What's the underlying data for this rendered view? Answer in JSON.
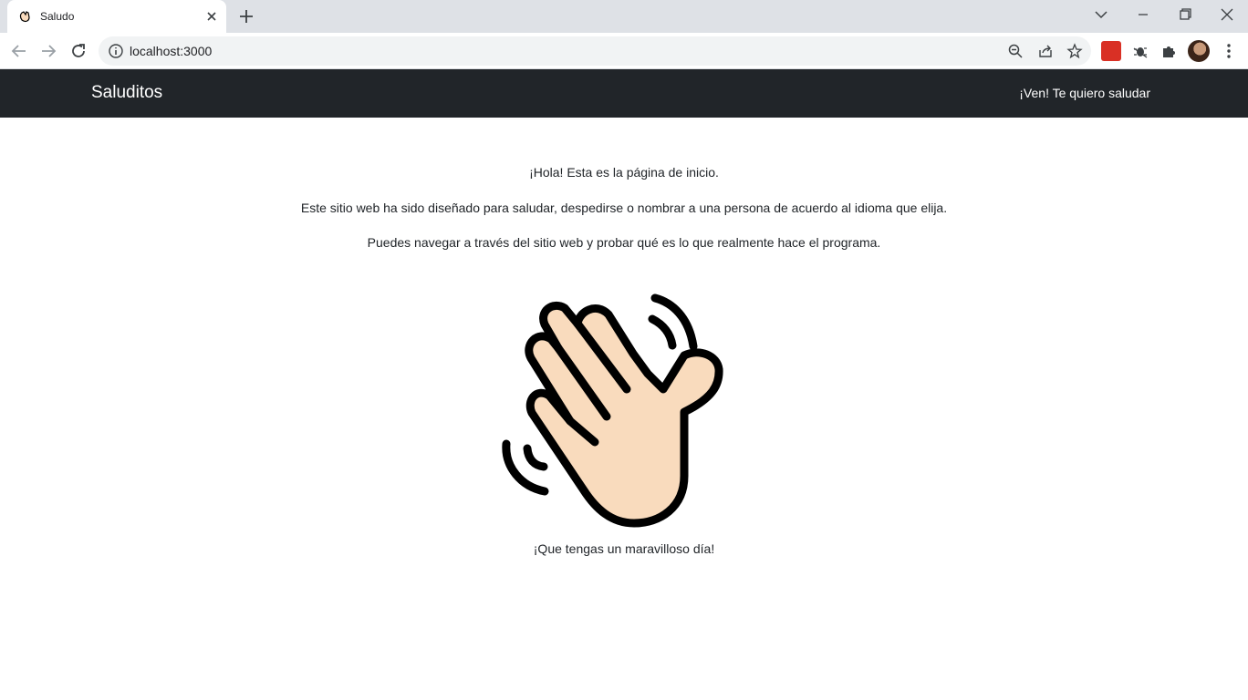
{
  "browser": {
    "tab": {
      "title": "Saludo"
    },
    "address_bar": {
      "url": "localhost:3000"
    }
  },
  "navbar": {
    "brand": "Saluditos",
    "link": "¡Ven! Te quiero saludar"
  },
  "main": {
    "intro": "¡Hola! Esta es la página de inicio.",
    "description": "Este sitio web ha sido diseñado para saludar, despedirse o nombrar a una persona de acuerdo al idioma que elija.",
    "instructions": "Puedes navegar a través del sitio web y probar qué es lo que realmente hace el programa.",
    "image_icon": "waving-hand-icon",
    "closing": "¡Que tengas un maravilloso día!"
  },
  "colors": {
    "navbar_bg": "#212529",
    "hand_fill": "#f9dbbd",
    "hand_outline": "#000000"
  }
}
